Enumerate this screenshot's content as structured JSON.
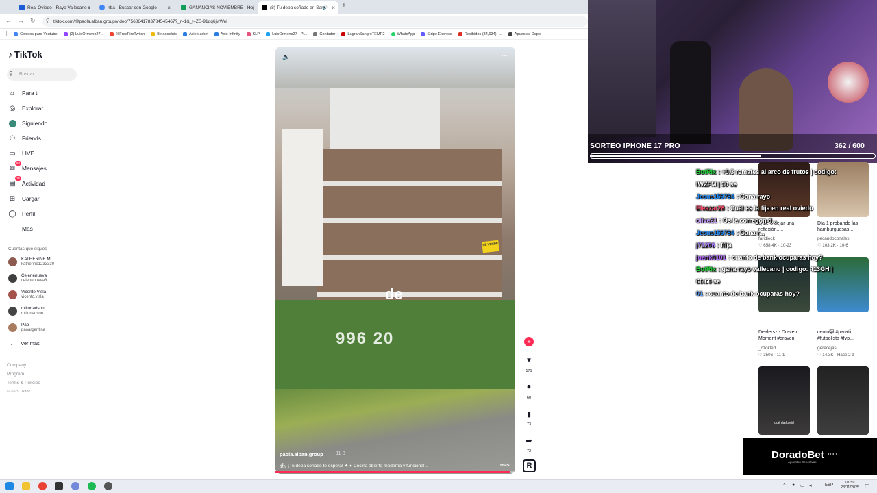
{
  "browser": {
    "tabs": [
      {
        "title": "Real Oviedo - Rayo Vallecano o",
        "color": "#1c5bd6",
        "active": false
      },
      {
        "title": "nba - Buscar con Google",
        "color": "#4285f4",
        "active": false
      },
      {
        "title": "GANANCIAS NOVIEMBRE - Hoj",
        "color": "#0f9d58",
        "active": false
      },
      {
        "title": "(8) Tu depa soñado en San",
        "color": "#000000",
        "active": true
      }
    ],
    "new_tab": "+",
    "url": "tiktok.com/@paola.alban.group/video/7568641783784545467?_r=1&_t=ZS-91dq6jwWel",
    "bookmarks": [
      {
        "label": "Correos para Youtube",
        "color": "#4285f4"
      },
      {
        "label": "(2) LuisOrmeno27...",
        "color": "#9146ff"
      },
      {
        "label": "%FreeFireTwitch",
        "color": "#e43"
      },
      {
        "label": "Binanceluis",
        "color": "#f0b90b"
      },
      {
        "label": "AxieMarket",
        "color": "#2a7de1"
      },
      {
        "label": "Axie Infinity",
        "color": "#2a7de1"
      },
      {
        "label": "SLP",
        "color": "#e2567c"
      },
      {
        "label": "LuisOrmeno27 - Pl...",
        "color": "#1da1f2"
      },
      {
        "label": "Contador",
        "color": "#777"
      },
      {
        "label": "LagranSangreTEMP2",
        "color": "#c00"
      },
      {
        "label": "WhatsApp",
        "color": "#25d366"
      },
      {
        "label": "Stripe Express",
        "color": "#635bff"
      },
      {
        "label": "Recibidos (34,934) -...",
        "color": "#d93025"
      },
      {
        "label": "Apuestas Depo",
        "color": "#444"
      }
    ]
  },
  "sidebar": {
    "logo": "TikTok",
    "search_placeholder": "Buscar",
    "nav": [
      {
        "label": "Para ti",
        "icon": "home-icon",
        "glyph": "⌂"
      },
      {
        "label": "Explorar",
        "icon": "compass-icon",
        "glyph": "◎"
      },
      {
        "label": "Siguiendo",
        "icon": "following-icon",
        "glyph": "●"
      },
      {
        "label": "Friends",
        "icon": "friends-icon",
        "glyph": "⚇"
      },
      {
        "label": "LIVE",
        "icon": "live-icon",
        "glyph": "▭"
      },
      {
        "label": "Mensajes",
        "icon": "messages-icon",
        "glyph": "✉",
        "badge": "64"
      },
      {
        "label": "Actividad",
        "icon": "activity-icon",
        "glyph": "▤",
        "badge": "15"
      },
      {
        "label": "Cargar",
        "icon": "upload-icon",
        "glyph": "⊞"
      },
      {
        "label": "Perfil",
        "icon": "profile-icon",
        "glyph": "◯"
      },
      {
        "label": "Más",
        "icon": "more-icon",
        "glyph": "···"
      }
    ],
    "following_title": "Cuentas que sigues",
    "following": [
      {
        "name": "KATHERINE M...",
        "handle": "katherine1233330"
      },
      {
        "name": "Celenenueva",
        "handle": "celenenueva3"
      },
      {
        "name": "Vicente Visla",
        "handle": "vicento.visla"
      },
      {
        "name": "millonadson",
        "handle": "millonadson"
      },
      {
        "name": "Pao",
        "handle": "paoargentina"
      }
    ],
    "see_more": "Ver más",
    "footer": [
      "Company",
      "Program",
      "Terms & Policies",
      "© 2025 TikTok"
    ]
  },
  "video": {
    "overlay_word": "de",
    "overlay_price": "996 20",
    "for_sale": "SE VENDE",
    "author": "paola.alban.group",
    "date": "· 11-3",
    "description": "¡Tu depa soñado te espera! ✦ ● Cocina abierta moderna y funcional...",
    "more": "más",
    "progress": 0.98,
    "likes": "171",
    "comments": "60",
    "saves": "73",
    "shares": "72"
  },
  "stream": {
    "sorteo_title": "SORTEO IPHONE 17 PRO",
    "sorteo_count": "362",
    "sorteo_total": "/ 600",
    "sorteo_progress": 0.6
  },
  "chat": [
    {
      "user": "BotRix",
      "user_color": "#22d33a",
      "text": ": +0.3 remates al arco de frutos | codigo:"
    },
    {
      "user": "",
      "user_color": "#fff",
      "text": "IWZFM | 30 se"
    },
    {
      "user": "Jesus159784",
      "user_color": "#1b8cff",
      "text": ": Gana rayo"
    },
    {
      "user": "Eleazar28",
      "user_color": "#ff4d6d",
      "text": ": Cuál es la fija en real oviedo"
    },
    {
      "user": "olive21",
      "user_color": "#c9a3ff",
      "text": ": Os la corregon d..."
    },
    {
      "user": "Jesus159784",
      "user_color": "#1b8cff",
      "text": ": Gana r..."
    },
    {
      "user": "j71206",
      "user_color": "#a57cff",
      "text": ": ffija"
    },
    {
      "user": "juank0101",
      "user_color": "#b36bff",
      "text": ": cuanto de bank ocuparas hoy?"
    },
    {
      "user": "BotRix",
      "user_color": "#22d33a",
      "text": ": gana rayo vallecano | codigo: 413GH |"
    },
    {
      "user": "",
      "user_color": "#fff",
      "text": "66.66 se"
    },
    {
      "user": "01",
      "user_color": "#5aa0ff",
      "text": ": cuanto de bank ocuparas hoy?"
    }
  ],
  "recommended": [
    {
      "caption": "Quiero dejar una reflexión.....",
      "author": "faridieck",
      "likes": "658.4K",
      "date": "10-23"
    },
    {
      "caption": "Día 1 probando las hamburguesas...",
      "author": "pecandoconalex",
      "likes": "103.2K",
      "date": "10-6"
    },
    {
      "caption": "Dealersz - Draven Moment #draven",
      "author": "_czokled",
      "likes": "3506",
      "date": "11-1"
    },
    {
      "caption": "centu😸 #paratii #futbolista #fyp...",
      "author": "gerecejas",
      "likes": "14.3K",
      "date": "Hace 2 d"
    },
    {
      "caption": "qué darkseid",
      "author": "",
      "likes": "",
      "date": ""
    },
    {
      "caption": "",
      "author": "",
      "likes": "",
      "date": ""
    }
  ],
  "ad": {
    "brand": "DoradoBet",
    "suffix": ".com",
    "sub": "Apuestas Deportivas"
  },
  "taskbar": {
    "lang": "ESP",
    "time": "07:59",
    "date": "23/11/2025"
  },
  "colors": {
    "tiktok_red": "#fe2c55",
    "accent_green": "#22d33a"
  }
}
